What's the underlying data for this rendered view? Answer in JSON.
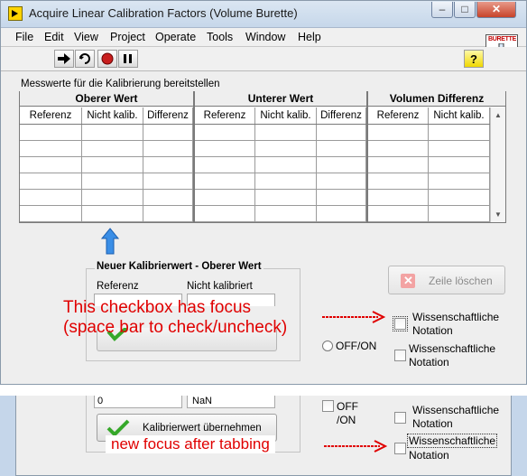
{
  "window": {
    "title": "Acquire Linear Calibration Factors (Volume Burette)",
    "logo_text": "BURETTE"
  },
  "menu": [
    "File",
    "Edit",
    "View",
    "Project",
    "Operate",
    "Tools",
    "Window",
    "Help"
  ],
  "table": {
    "caption": "Messwerte für die Kalibrierung bereitstellen",
    "groups": [
      "Oberer Wert",
      "Unterer Wert",
      "Volumen Differenz"
    ],
    "columns": [
      "Referenz",
      "Nicht kalib.",
      "Differenz",
      "Referenz",
      "Nicht kalib.",
      "Differenz",
      "Referenz",
      "Nicht kalib."
    ]
  },
  "new_value": {
    "title": "Neuer Kalibrierwert - Oberer Wert",
    "ref_label": "Referenz",
    "uncal_label": "Nicht kalibriert",
    "ref_value": "0",
    "uncal_value": "NaN",
    "apply_label": "Kalibrierwert übernehmen"
  },
  "delete_row_label": "Zeile löschen",
  "toggle_label": "OFF/ON",
  "toggle_label_split": [
    "OFF",
    "/ON"
  ],
  "checkbox_label": [
    "Wissenschaftliche",
    "Notation"
  ],
  "annotations": {
    "focus_line1": "This checkbox has focus",
    "focus_line2": "(space bar to check/uncheck)",
    "new_focus": "new focus after tabbing"
  },
  "colors": {
    "annotation": "#e00000",
    "arrow_up": "#3a8ee6",
    "checkmark": "#36a82a"
  }
}
